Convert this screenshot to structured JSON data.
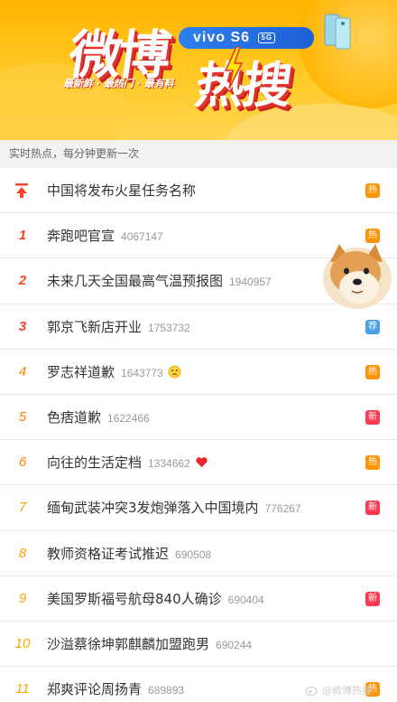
{
  "banner": {
    "title_part1": "微博",
    "title_part2": "热搜",
    "brand": "vivo S6",
    "brand_badge": "5G",
    "slogan": "最新鲜 · 最热门 · 最有料"
  },
  "section_header": "实时热点，每分钟更新一次",
  "rows": [
    {
      "rank": "",
      "topic": "中国将发布火星任务名称",
      "count": "",
      "tag": "热",
      "tag_type": "hot",
      "pinned": true
    },
    {
      "rank": "1",
      "topic": "奔跑吧官宣",
      "count": "4067147",
      "tag": "热",
      "tag_type": "hot"
    },
    {
      "rank": "2",
      "topic": "未来几天全国最高气温预报图",
      "count": "1940957",
      "tag": "",
      "tag_type": ""
    },
    {
      "rank": "3",
      "topic": "郭京飞新店开业",
      "count": "1753732",
      "tag": "荐",
      "tag_type": "rec"
    },
    {
      "rank": "4",
      "topic": "罗志祥道歉",
      "count": "1643773",
      "tag": "热",
      "tag_type": "hot",
      "emoji": "thinking-face-icon"
    },
    {
      "rank": "5",
      "topic": "色痞道歉",
      "count": "1622466",
      "tag": "新",
      "tag_type": "new"
    },
    {
      "rank": "6",
      "topic": "向往的生活定档",
      "count": "1334662",
      "tag": "热",
      "tag_type": "hot",
      "emoji": "heart-icon"
    },
    {
      "rank": "7",
      "topic": "缅甸武装冲突3发炮弹落入中国境内",
      "count": "776267",
      "tag": "新",
      "tag_type": "new"
    },
    {
      "rank": "8",
      "topic": "教师资格证考试推迟",
      "count": "690508",
      "tag": "",
      "tag_type": ""
    },
    {
      "rank": "9",
      "topic": "美国罗斯福号航母840人确诊",
      "count": "690404",
      "tag": "新",
      "tag_type": "new"
    },
    {
      "rank": "10",
      "topic": "沙溢蔡徐坤郭麒麟加盟跑男",
      "count": "690244",
      "tag": "",
      "tag_type": ""
    },
    {
      "rank": "11",
      "topic": "郑爽评论周扬青",
      "count": "689893",
      "tag": "热",
      "tag_type": "hot"
    }
  ],
  "watermark": "@微博热搜",
  "colors": {
    "rank_top": "#f2462a",
    "rank_mid": "#ff8200",
    "tag_hot": "#ff9406",
    "tag_new": "#ff3852",
    "tag_rec": "#4b9ee8"
  }
}
